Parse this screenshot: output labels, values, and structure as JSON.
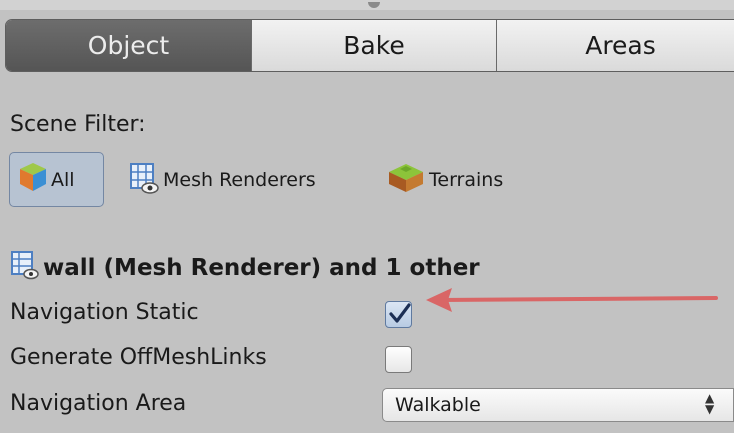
{
  "tabs": [
    {
      "label": "Object",
      "active": true
    },
    {
      "label": "Bake",
      "active": false
    },
    {
      "label": "Areas",
      "active": false
    }
  ],
  "scene_filter": {
    "label": "Scene Filter:",
    "buttons": [
      {
        "label": "All",
        "icon": "cube-icon",
        "selected": true
      },
      {
        "label": "Mesh Renderers",
        "icon": "mesh-renderer-icon",
        "selected": false
      },
      {
        "label": "Terrains",
        "icon": "terrain-icon",
        "selected": false
      }
    ]
  },
  "selection": {
    "title": "wall (Mesh Renderer) and 1 other",
    "icon": "mesh-renderer-icon"
  },
  "properties": {
    "navigation_static": {
      "label": "Navigation Static",
      "checked": true
    },
    "generate_offmeshlinks": {
      "label": "Generate OffMeshLinks",
      "checked": false
    },
    "navigation_area": {
      "label": "Navigation Area",
      "value": "Walkable"
    }
  },
  "colors": {
    "active_tab": "#5e5e5e",
    "panel_bg": "#c2c2c2",
    "selected_filter": "#b7c3d2",
    "annotation_arrow": "#d96666",
    "checkmark": "#1c2f55"
  }
}
